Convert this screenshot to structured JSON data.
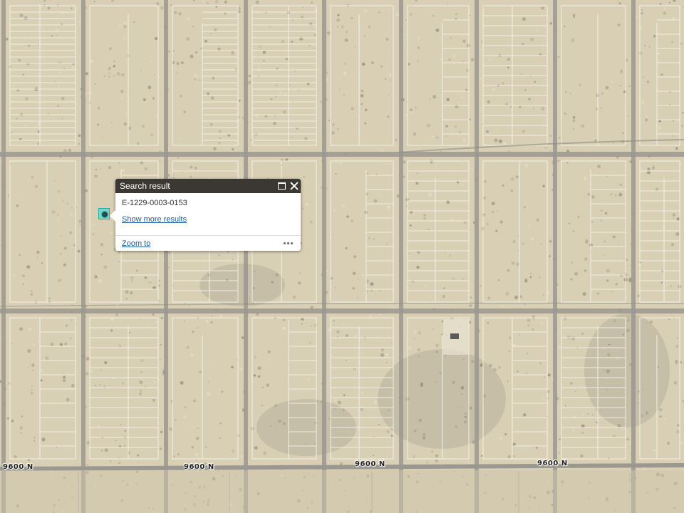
{
  "map": {
    "road_labels": [
      "9600 N",
      "9600 N",
      "9600 N",
      "9600 N"
    ]
  },
  "popup": {
    "title": "Search result",
    "result_id": "E-1229-0003-0153",
    "show_more_label": "Show more results",
    "zoom_to_label": "Zoom to",
    "maximize_icon": "maximize-icon",
    "close_icon": "close-icon",
    "more_icon": "ellipsis-icon"
  },
  "colors": {
    "terrain": "#d9cfb4",
    "road": "#9a9890",
    "lot_lines": "#f4f1e8",
    "popup_header": "#3b3733",
    "link": "#1a5c9e",
    "marker": "#00c8c8"
  }
}
